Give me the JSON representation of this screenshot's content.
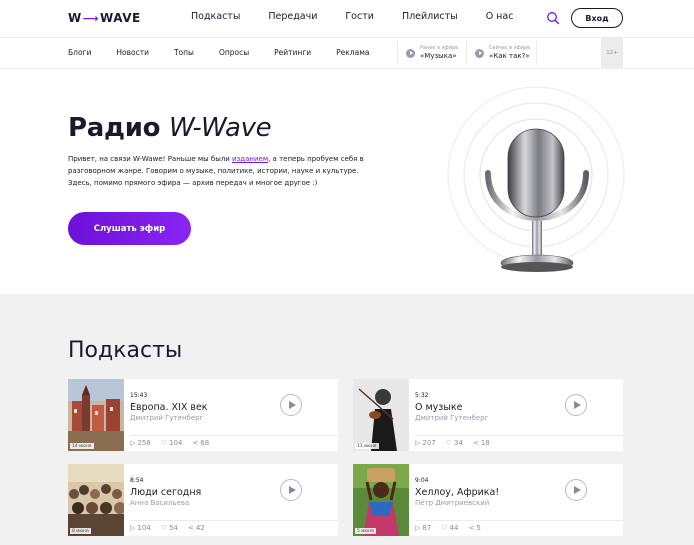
{
  "header": {
    "logo_left": "W",
    "logo_right": "WAVE",
    "nav": [
      "Подкасты",
      "Передачи",
      "Гости",
      "Плейлисты",
      "О нас"
    ],
    "login_label": "Вход"
  },
  "subnav": {
    "items": [
      "Блоги",
      "Новости",
      "Топы",
      "Опросы",
      "Рейтинги",
      "Реклама"
    ],
    "previous": {
      "label": "Ранее в эфире",
      "title": "«Музыка»"
    },
    "current": {
      "label": "Сейчас в эфире",
      "title": "«Как так?»"
    },
    "age_rating": "12+"
  },
  "hero": {
    "title_main": "Радио",
    "title_brand": "W-Wave",
    "text_before_link": "Привет, на связи W-Wawe! Раньше мы были ",
    "text_link": "изданием",
    "text_after_link": ", а теперь пробуем себя в разговорном жанре. Говорим о музыке, политике, истории, науке и культуре. Здесь, помимо прямого эфира — архив передач и многое другое :)",
    "listen_label": "Слушать эфир"
  },
  "podcasts": {
    "title": "Подкасты",
    "items": [
      {
        "time": "15:43",
        "title": "Европа. XIX век",
        "author": "Дмитрий Гутенберг",
        "age": "14 июня",
        "plays": "258",
        "likes": "104",
        "shares": "68"
      },
      {
        "time": "5:32",
        "title": "О музыке",
        "author": "Дмитрий Гутенберг",
        "age": "11 июня",
        "plays": "207",
        "likes": "34",
        "shares": "18"
      },
      {
        "time": "8:54",
        "title": "Люди сегодня",
        "author": "Анна Васильева",
        "age": "8 июня",
        "plays": "104",
        "likes": "54",
        "shares": "42"
      },
      {
        "time": "9:04",
        "title": "Хеллоу, Африка!",
        "author": "Пётр Дмитриевский",
        "age": "5 июня",
        "plays": "87",
        "likes": "44",
        "shares": "5"
      }
    ]
  },
  "colors": {
    "accent": "#7a17e8",
    "text": "#1a1a2e",
    "muted": "#9b9bb0",
    "page_bg": "#f1f1f1"
  }
}
